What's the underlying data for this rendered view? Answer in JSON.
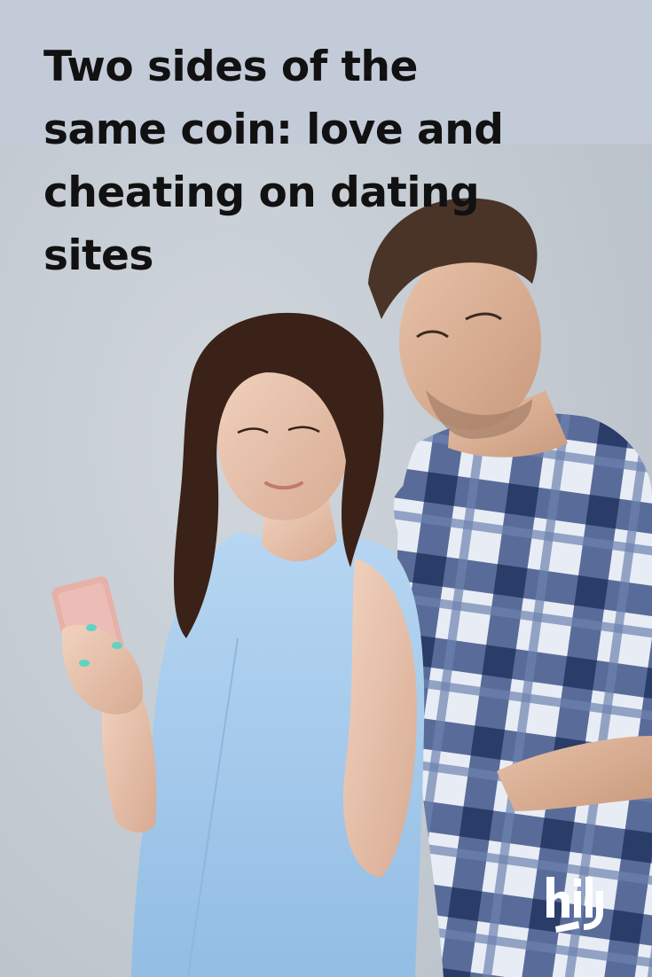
{
  "headline": "Two sides of the same coin: love and cheating on dating sites",
  "brand_logo": "hily",
  "colors": {
    "background": "#c9d0d6",
    "headline_band": "#c3cbd8",
    "headline_text": "#111111",
    "logo": "#ffffff",
    "woman_top": "#a9cdee",
    "man_shirt_dark": "#3f5688",
    "man_shirt_light": "#e9eef6",
    "phone": "#e7b0a8"
  }
}
